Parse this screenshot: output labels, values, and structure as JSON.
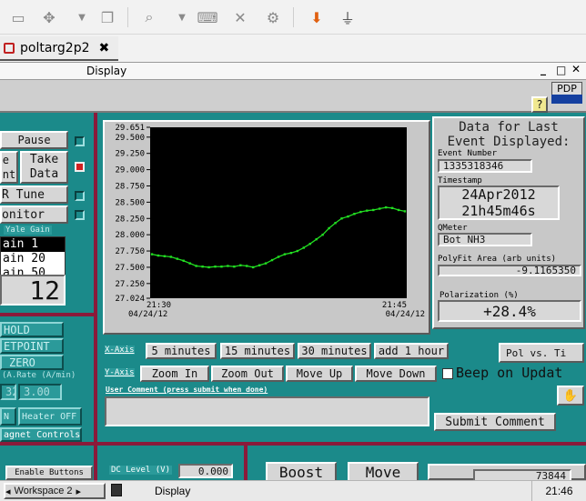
{
  "tab": {
    "title": "poltarg2p2"
  },
  "window": {
    "title": "Display"
  },
  "header": {
    "pdp": "PDP",
    "help": "?"
  },
  "left": {
    "pause": "Pause",
    "take_left": "e\nnt",
    "take_data": "Take\nData",
    "r_tune": "R Tune",
    "monitor": "onitor",
    "yale_gain_label": "Yale Gain",
    "gain_options": [
      "ain 1",
      "ain 20",
      "ain 50"
    ],
    "gain_selected": 0,
    "big_value": "12",
    "hold": "HOLD",
    "setpoint": "ETPOINT",
    "zero": "ZERO",
    "rate_label": "(A.Rate (A/min)",
    "rate_value_left": "32",
    "rate_value": "3.00",
    "n_btn": "N",
    "heater_off": "Heater OFF",
    "magnet_controls": "agnet Controls",
    "enable_buttons": "Enable Buttons",
    "dc_level_label": "DC Level (V)",
    "dc_level_value": "0.000"
  },
  "chart_data": {
    "type": "line",
    "x": [
      "21:30",
      "",
      "",
      "",
      "",
      "",
      "",
      "",
      "",
      "",
      "",
      "",
      "",
      "",
      "",
      "",
      "",
      "",
      "",
      "",
      "",
      "",
      "",
      "",
      "",
      "",
      "",
      "",
      "",
      "",
      "",
      "",
      "",
      "",
      "",
      "",
      "",
      "",
      "",
      "",
      "21:45"
    ],
    "values": [
      27.7,
      27.68,
      27.67,
      27.66,
      27.63,
      27.6,
      27.56,
      27.52,
      27.51,
      27.5,
      27.51,
      27.51,
      27.52,
      27.51,
      27.53,
      27.52,
      27.5,
      27.53,
      27.56,
      27.61,
      27.66,
      27.7,
      27.72,
      27.75,
      27.8,
      27.86,
      27.93,
      28.0,
      28.1,
      28.18,
      28.25,
      28.28,
      28.32,
      28.35,
      28.37,
      28.38,
      28.4,
      28.42,
      28.41,
      28.38,
      28.36
    ],
    "ylim": [
      27.024,
      29.651
    ],
    "y_ticks": [
      "29.651",
      "29.500",
      "29.250",
      "29.000",
      "28.750",
      "28.500",
      "28.250",
      "28.000",
      "27.750",
      "27.500",
      "27.250",
      "27.024"
    ],
    "x_tick_labels": [
      {
        "time": "21:30",
        "date": "04/24/12"
      },
      {
        "time": "21:45",
        "date": "04/24/12"
      }
    ],
    "line_color": "#22dd22",
    "background": "#000000",
    "grid": false
  },
  "data_panel": {
    "title": "Data for Last\nEvent Displayed:",
    "event_number_label": "Event Number",
    "event_number": "1335318346",
    "timestamp_label": "Timestamp",
    "timestamp_date": "24Apr2012",
    "timestamp_time": "21h45m46s",
    "qmeter_label": "QMeter",
    "qmeter": "Bot NH3",
    "polyfit_label": "PolyFit Area (arb units)",
    "polyfit": "-9.1165350",
    "polarization_label": "Polarization (%)",
    "polarization": "+28.4%"
  },
  "controls": {
    "x_axis_label": "X-Axis",
    "y_axis_label": "Y-Axis",
    "x_buttons": [
      "5 minutes",
      "15 minutes",
      "30 minutes",
      "add 1 hour"
    ],
    "y_buttons": [
      "Zoom In",
      "Zoom Out",
      "Move Up",
      "Move Down"
    ],
    "pol_vs_time": "Pol vs. Ti",
    "beep": "Beep on Updat",
    "comment_label": "User Comment (press submit when done)",
    "submit": "Submit Comment",
    "boost": "Boost",
    "move": "Move",
    "bottom_right_value": "73844"
  },
  "taskbar": {
    "workspace": "Workspace 2",
    "display": "Display",
    "time": "21:46"
  }
}
